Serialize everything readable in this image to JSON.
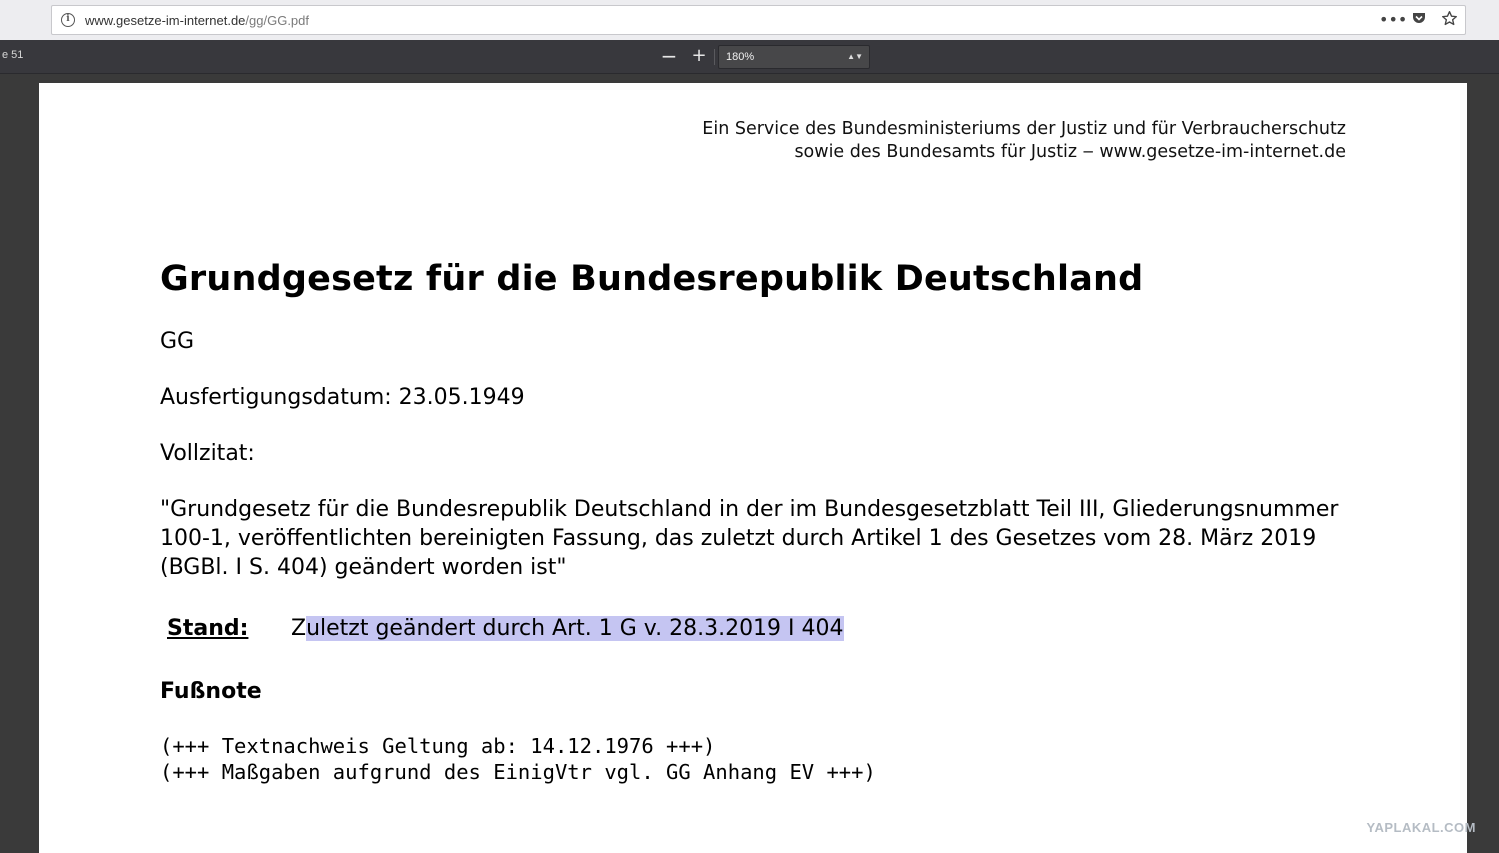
{
  "browser": {
    "url_host": "www.gesetze-im-internet.de",
    "url_path": "/gg/GG.pdf",
    "actions": [
      "more-icon",
      "pocket-icon",
      "bookmark-star-icon"
    ]
  },
  "pdf_toolbar": {
    "page_label": "e 51",
    "zoom_out": "−",
    "zoom_in": "+",
    "zoom_value": "180%",
    "zoom_arrows": "▲▼"
  },
  "document": {
    "service_line1": "Ein Service des Bundesministeriums der Justiz und für Verbraucherschutz",
    "service_line2": "sowie des Bundesamts für Justiz ‒ www.gesetze-im-internet.de",
    "title": "Grundgesetz für die Bundesrepublik Deutschland",
    "abbreviation": "GG",
    "ausfertigungsdatum": "Ausfertigungsdatum: 23.05.1949",
    "vollzitat_label": "Vollzitat:",
    "vollzitat_text": "\"Grundgesetz für die Bundesrepublik Deutschland in der im Bundesgesetzblatt Teil III, Gliederungsnummer 100-1, veröffentlichten bereinigten Fassung, das zuletzt durch Artikel 1 des Gesetzes vom 28. März 2019 (BGBl. I S. 404) geändert worden ist\"",
    "stand_label": "Stand:",
    "stand_first": "Z",
    "stand_highlighted": "uletzt geändert durch Art. 1 G v. 28.3.2019 I 404",
    "fussnote_label": "Fußnote",
    "footnote_line1": "(+++ Textnachweis Geltung ab: 14.12.1976 +++)",
    "footnote_line2": "(+++ Maßgaben aufgrund des EinigVtr vgl. GG Anhang EV +++)"
  },
  "watermark": "YAPLAKAL.COM",
  "colors": {
    "selection_highlight": "#c5c5f2",
    "toolbar_bg": "#38383d",
    "viewer_bg": "#3a3a3a"
  }
}
